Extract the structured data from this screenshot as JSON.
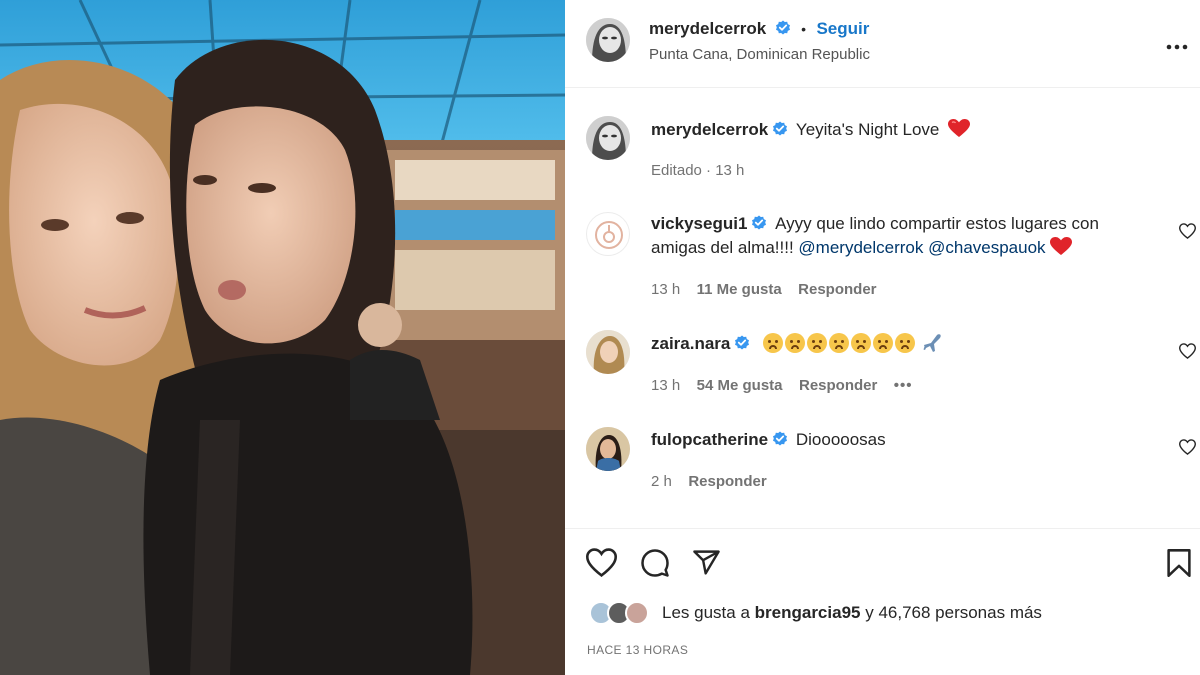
{
  "post": {
    "author": "merydelcerrok",
    "follow_label": "Seguir",
    "separator": "•",
    "location": "Punta Cana, Dominican Republic",
    "caption_author": "merydelcerrok",
    "caption_text": "Yeyita's Night Love",
    "caption_meta": "Editado · 13 h"
  },
  "comments": [
    {
      "user": "vickysegui1",
      "line1": "Ayyy que lindo compartir estos lugares con",
      "line2_text": "amigas del alma!!!!",
      "mention1": "@merydelcerrok",
      "mention2": "@chavespauok",
      "time": "13 h",
      "likes": "11 Me gusta",
      "reply": "Responder"
    },
    {
      "user": "zaira.nara",
      "time": "13 h",
      "likes": "54 Me gusta",
      "reply": "Responder",
      "more": "•••"
    },
    {
      "user": "fulopcatherine",
      "text": "Diooooosas",
      "time": "2 h",
      "reply": "Responder"
    }
  ],
  "likes": {
    "prefix": "Les gusta a",
    "user": "brengarcia95",
    "suffix": "y 46,768 personas más"
  },
  "time_ago": "HACE 13 HORAS",
  "icons": {
    "like": "heart-icon",
    "comment": "comment-icon",
    "share": "share-icon",
    "save": "bookmark-icon",
    "more": "more-options-icon",
    "verified": "verified-badge-icon"
  },
  "colors": {
    "link": "#1877c9",
    "verified": "#3897f0",
    "heart": "#ed1c24",
    "muted": "#737373"
  }
}
